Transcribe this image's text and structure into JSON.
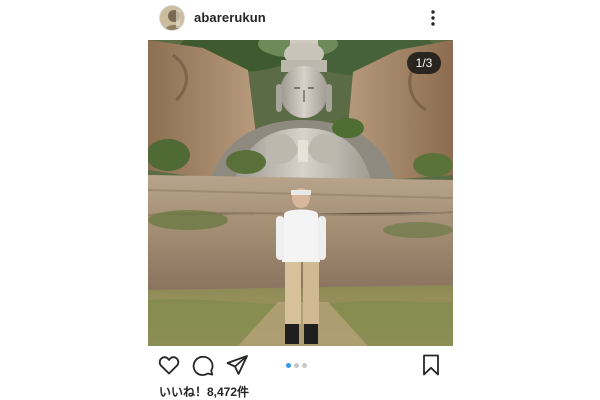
{
  "post": {
    "username": "abarerukun",
    "image_counter": "1/3",
    "likes_text": "いいね！8,472件",
    "carousel": {
      "total": 3,
      "active_index": 0
    }
  },
  "icons": {
    "avatar": "avatar",
    "more": "more-vertical-icon",
    "like": "heart-icon",
    "comment": "comment-bubble-icon",
    "share": "paper-plane-icon",
    "save": "bookmark-icon"
  },
  "colors": {
    "text": "#262626",
    "dot_active": "#3897f0",
    "dot_inactive": "#c7c7c7",
    "counter_bg": "#121212"
  }
}
